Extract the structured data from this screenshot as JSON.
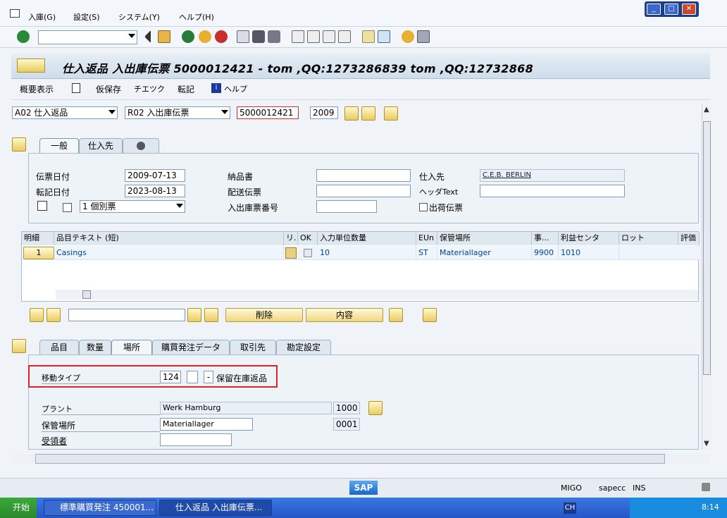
{
  "menu": {
    "items": [
      "入庫(G)",
      "設定(S)",
      "システム(Y)",
      "ヘルプ(H)"
    ]
  },
  "title": "仕入返品 入出庫伝票 5000012421 - tom ,QQ:1273286839 tom ,QQ:12732868",
  "appbar": {
    "overview": "概要表示",
    "hold": "仮保存",
    "check": "チエツク",
    "post": "転記",
    "help": "ヘルプ"
  },
  "header": {
    "action": "A02 仕入返品",
    "ref": "R02 入出庫伝票",
    "docno": "5000012421",
    "year": "2009"
  },
  "toptabs": [
    "一般",
    "仕入先"
  ],
  "general": {
    "doc_date_label": "伝票日付",
    "doc_date": "2009-07-13",
    "post_date_label": "転記日付",
    "post_date": "2023-08-13",
    "slip": "1 個別票",
    "delivery_note_label": "納品書",
    "bill_label": "配送伝票",
    "gr_slip_label": "入出庫票番号",
    "vendor_label": "仕入先",
    "vendor": "C.E.B. BERLIN",
    "header_text_label": "ヘッダText",
    "outbound_label": "出荷伝票"
  },
  "grid": {
    "headers": [
      "明細",
      "品目テキスト (短)",
      "リ.",
      "OK",
      "入力単位数量",
      "EUn",
      "保管場所",
      "事...",
      "利益センタ",
      "ロット",
      "評価"
    ],
    "row": {
      "line": "1",
      "text": "Casings",
      "qty": "10",
      "unit": "ST",
      "sloc": "Materiallager",
      "plant": "9900",
      "profit": "1010"
    }
  },
  "buttons": {
    "delete": "削除",
    "content": "内容"
  },
  "itemtabs": [
    "品目",
    "数量",
    "場所",
    "購買発注データ",
    "取引先",
    "勘定設定"
  ],
  "detail": {
    "movetype_label": "移動タイプ",
    "movetype": "124",
    "movetype_text": "保留在庫返品",
    "plant_label": "プラント",
    "plant_name": "Werk Hamburg",
    "plant_code": "1000",
    "sloc_label": "保管場所",
    "sloc_name": "Materiallager",
    "sloc_code": "0001",
    "recipient_label": "受領者"
  },
  "status": {
    "tcode": "MIGO",
    "server": "sapecc",
    "mode": "INS"
  },
  "taskbar": {
    "start": "开始",
    "task1": "標準購買発注 450001...",
    "task2": "仕入返品 入出庫伝票...",
    "lang": "CH",
    "time": "8:14"
  }
}
